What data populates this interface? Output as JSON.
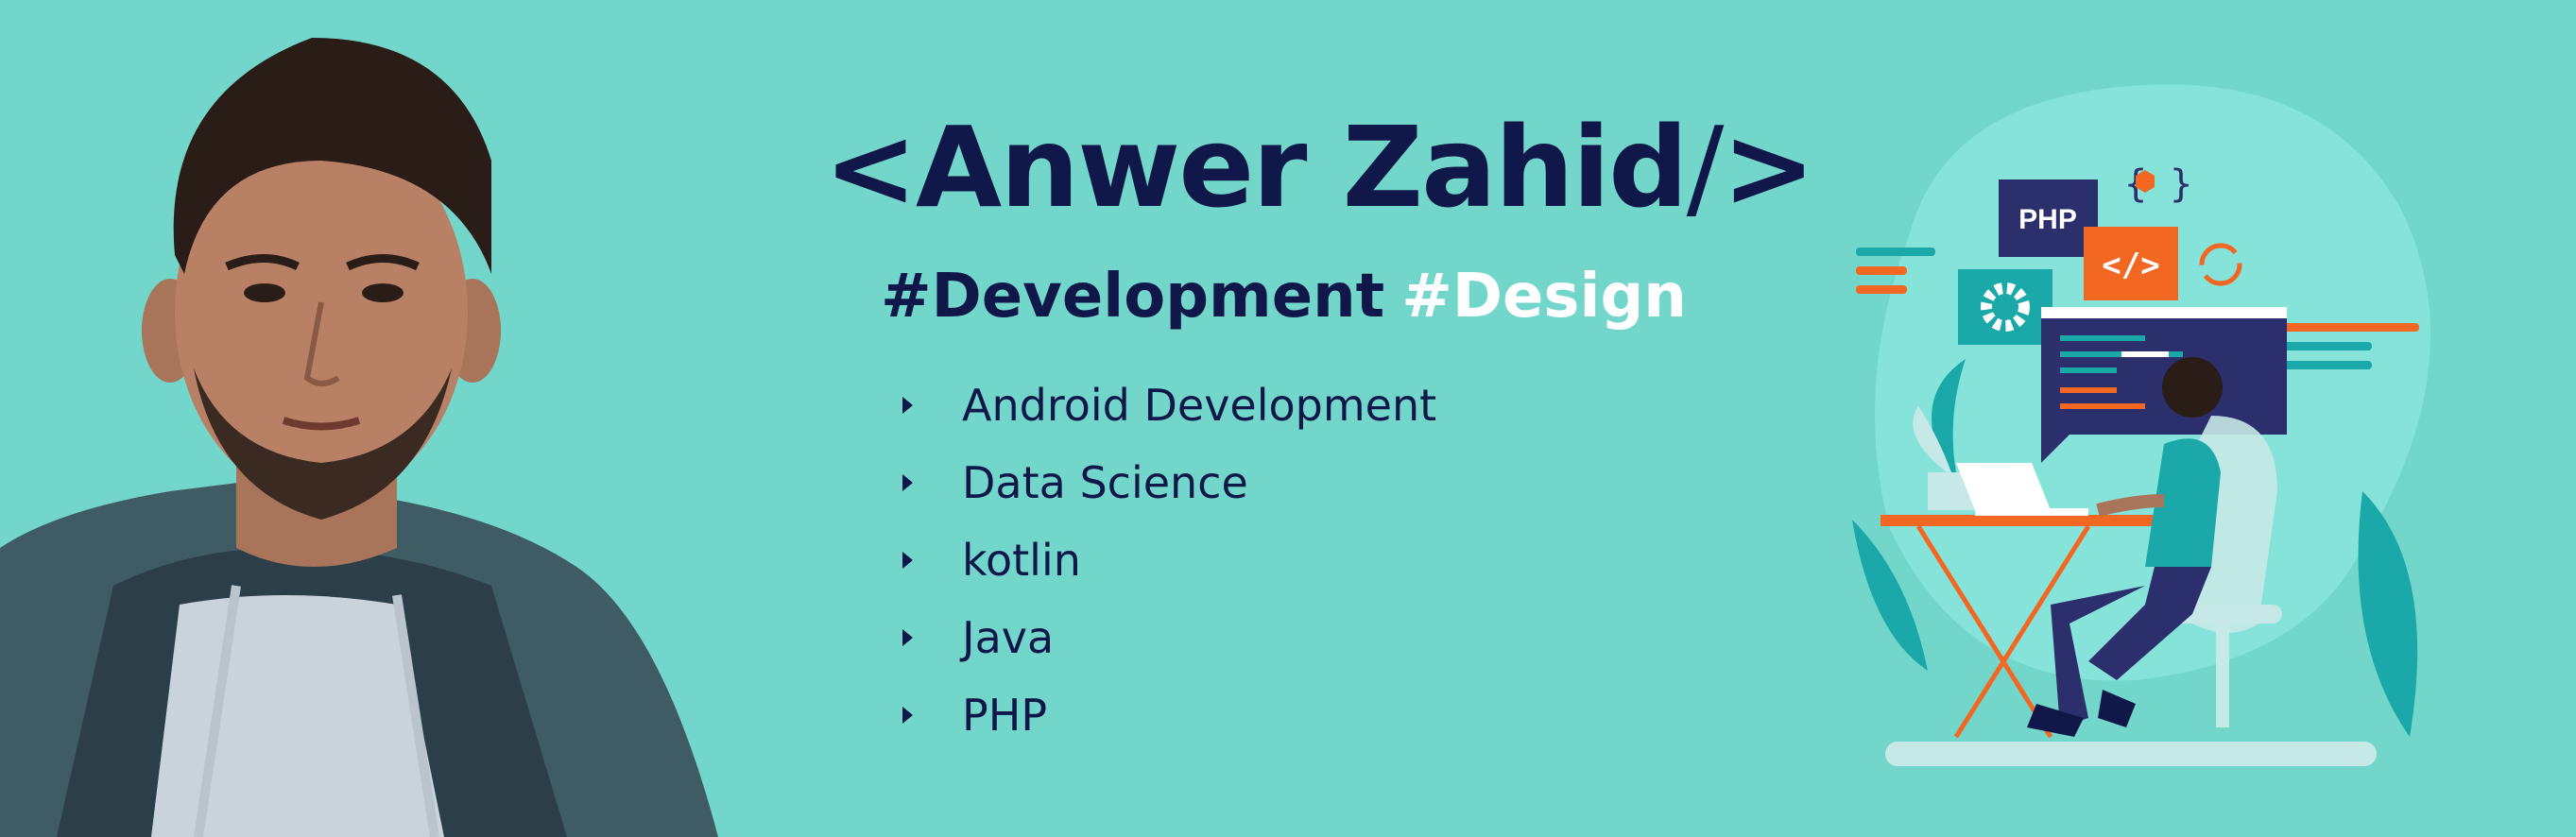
{
  "banner": {
    "title": {
      "open_tag": "<Anwer Zahid",
      "slash": "/",
      "close_tag": ">"
    },
    "hashtags": [
      "#Development",
      "#Design"
    ],
    "skills": [
      "Android Development",
      "Data Science",
      "kotlin",
      "Java",
      "PHP"
    ],
    "illustration": {
      "badge_php": "PHP",
      "badge_code": "</>",
      "badge_braces": "{ }"
    }
  },
  "colors": {
    "background": "#73d6cb",
    "navy": "#101849",
    "orange": "#f26722",
    "teal_dark": "#1aa9a8",
    "white": "#ffffff"
  },
  "icons": [
    "bullet-icon",
    "gear-icon",
    "code-icon",
    "sync-icon",
    "hexagon-icon"
  ]
}
